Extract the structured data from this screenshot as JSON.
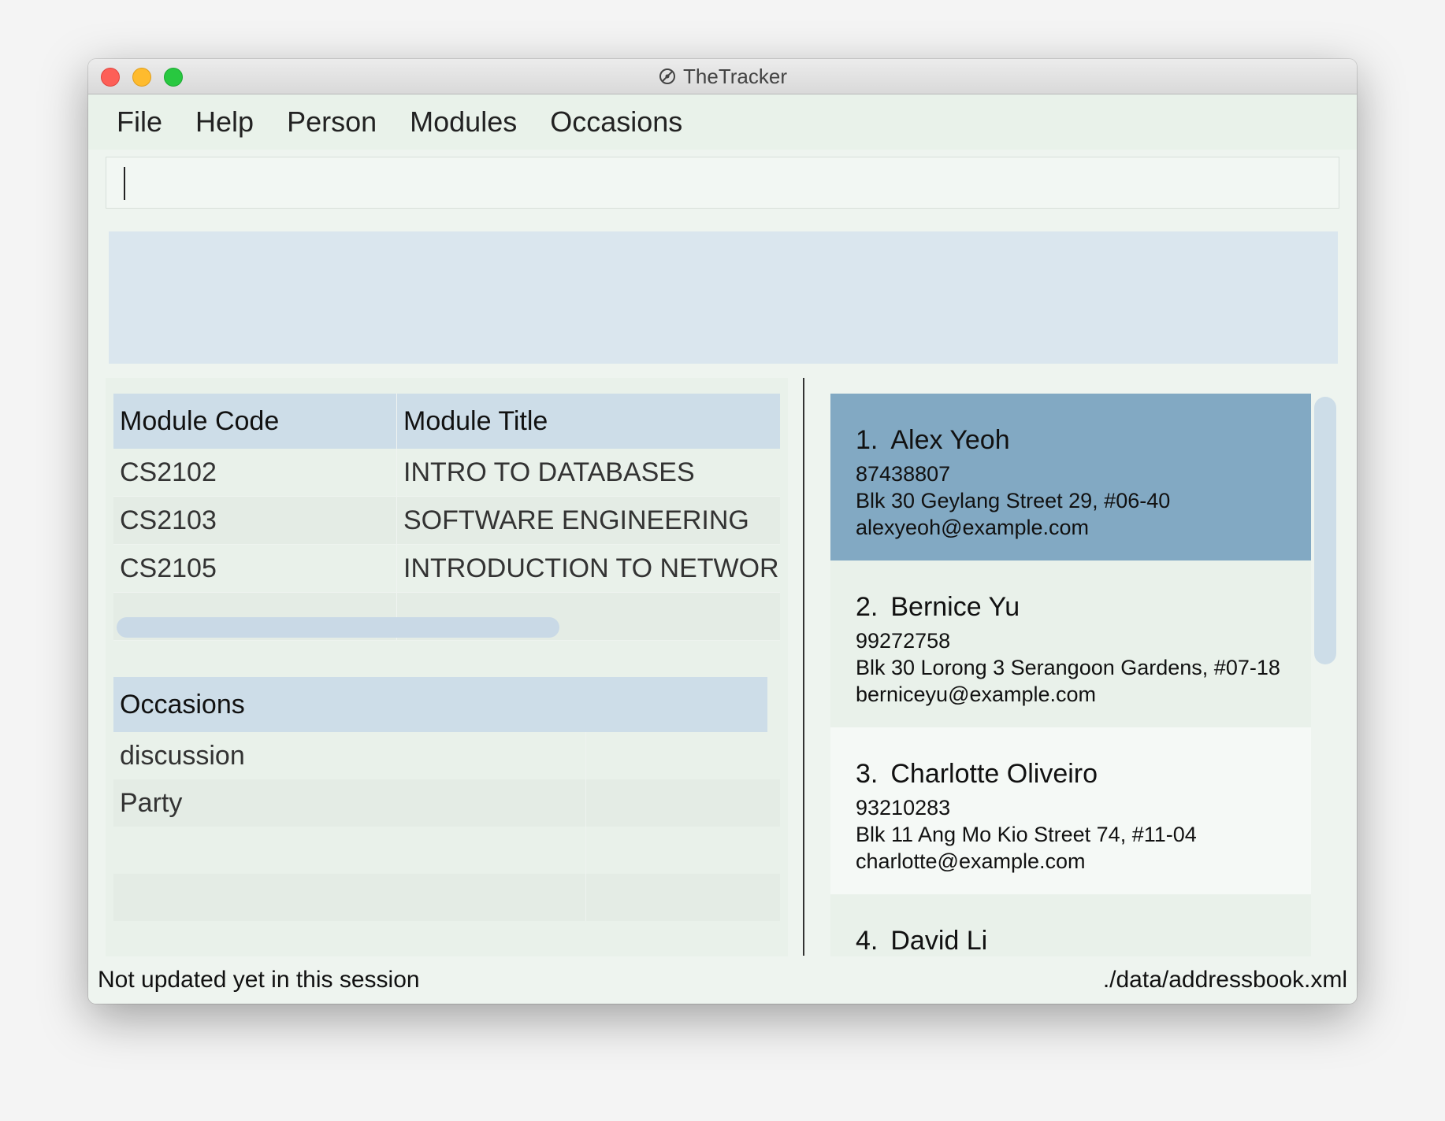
{
  "window": {
    "title": "TheTracker"
  },
  "menu": [
    "File",
    "Help",
    "Person",
    "Modules",
    "Occasions"
  ],
  "command": {
    "value": ""
  },
  "modules": {
    "headers": [
      "Module Code",
      "Module Title"
    ],
    "rows": [
      {
        "code": "CS2102",
        "title": "INTRO TO DATABASES"
      },
      {
        "code": "CS2103",
        "title": "SOFTWARE ENGINEERING"
      },
      {
        "code": "CS2105",
        "title": "INTRODUCTION TO NETWORKS"
      }
    ]
  },
  "occasions": {
    "header": "Occasions",
    "rows": [
      "discussion",
      "Party"
    ]
  },
  "persons": [
    {
      "index": "1.",
      "name": "Alex Yeoh",
      "phone": "87438807",
      "address": "Blk 30 Geylang Street 29, #06-40",
      "email": "alexyeoh@example.com"
    },
    {
      "index": "2.",
      "name": "Bernice Yu",
      "phone": "99272758",
      "address": "Blk 30 Lorong 3 Serangoon Gardens, #07-18",
      "email": "berniceyu@example.com"
    },
    {
      "index": "3.",
      "name": "Charlotte Oliveiro",
      "phone": "93210283",
      "address": "Blk 11 Ang Mo Kio Street 74, #11-04",
      "email": "charlotte@example.com"
    },
    {
      "index": "4.",
      "name": "David Li",
      "phone": "",
      "address": "",
      "email": ""
    }
  ],
  "status": {
    "sync": "Not updated yet in this session",
    "path": "./data/addressbook.xml"
  },
  "colors": {
    "selected_card": "#82a9c3",
    "header_bg": "#cddde8",
    "result_bg": "#dae6ee"
  }
}
